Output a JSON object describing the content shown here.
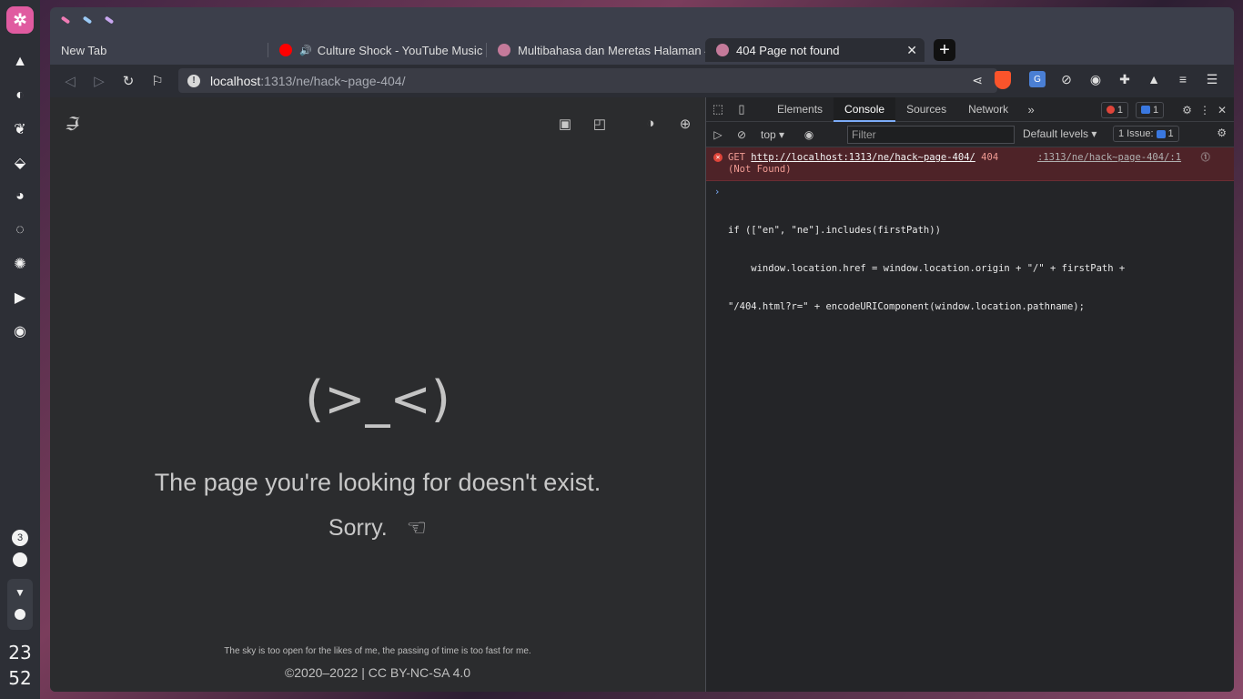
{
  "dock": {
    "badge_count": "3",
    "clock_hour": "23",
    "clock_minute": "52"
  },
  "tabs": [
    {
      "title": "New Tab"
    },
    {
      "title": "Culture Shock - YouTube Music"
    },
    {
      "title": "Multibahasa dan Meretas Halaman 404"
    },
    {
      "title": "404 Page not found"
    }
  ],
  "toolbar": {
    "url_host": "localhost",
    "url_path": ":1313/ne/hack~page-404/"
  },
  "page": {
    "face": "(>_<)",
    "message": "The page you're looking for doesn't exist.",
    "sorry": "Sorry.",
    "quote": "The sky is too open for the likes of me, the passing of time is too fast for me.",
    "copyright": "©2020–2022 | CC BY-NC-SA 4.0"
  },
  "devtools": {
    "tabs": [
      "Elements",
      "Console",
      "Sources",
      "Network"
    ],
    "error_count": "1",
    "message_count": "1",
    "context": "top",
    "filter_placeholder": "Filter",
    "levels": "Default levels",
    "issues_label": "1 Issue:",
    "issues_count": "1",
    "error": {
      "method": "GET",
      "url": "http://localhost:1313/ne/hack~page-404/",
      "status": "404",
      "status_text": "(Not Found)",
      "source": ":1313/ne/hack~page-404/:1"
    },
    "code_lines": [
      "if ([\"en\", \"ne\"].includes(firstPath))",
      "    window.location.href = window.location.origin + \"/\" + firstPath +",
      "\"/404.html?r=\" + encodeURIComponent(window.location.pathname);"
    ]
  },
  "colors": {
    "accent": "#e05ba0",
    "error_bg": "#4e2328",
    "devtools_active": "#7cacf8"
  }
}
